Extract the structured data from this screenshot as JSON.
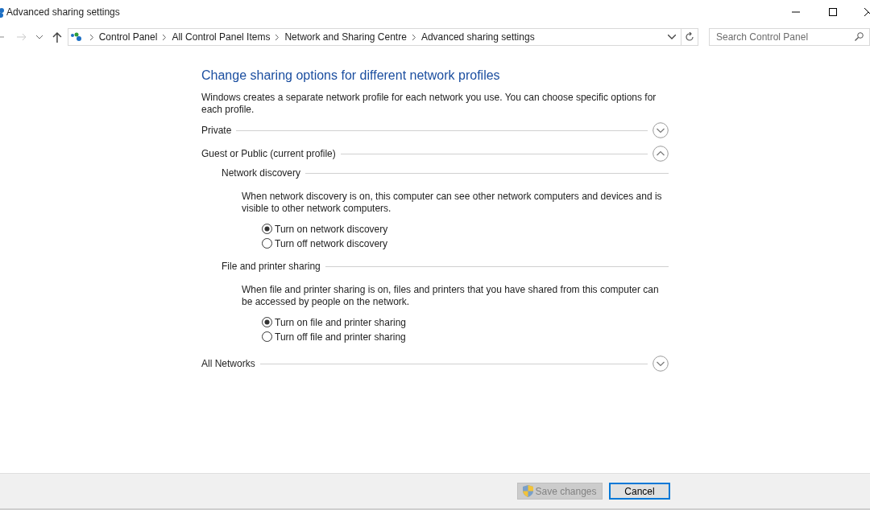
{
  "window": {
    "title": "Advanced sharing settings"
  },
  "address_bar": {
    "breadcrumbs": [
      "Control Panel",
      "All Control Panel Items",
      "Network and Sharing Centre",
      "Advanced sharing settings"
    ]
  },
  "search": {
    "placeholder": "Search Control Panel"
  },
  "heading": "Change sharing options for different network profiles",
  "intro": "Windows creates a separate network profile for each network you use. You can choose specific options for each profile.",
  "profiles": [
    {
      "title": "Private",
      "expanded": false
    },
    {
      "title": "Guest or Public (current profile)",
      "expanded": true,
      "groups": [
        {
          "title": "Network discovery",
          "description": "When network discovery is on, this computer can see other network computers and devices and is visible to other network computers.",
          "options": [
            {
              "label": "Turn on network discovery",
              "selected": true
            },
            {
              "label": "Turn off network discovery",
              "selected": false
            }
          ]
        },
        {
          "title": "File and printer sharing",
          "description": "When file and printer sharing is on, files and printers that you have shared from this computer can be accessed by people on the network.",
          "options": [
            {
              "label": "Turn on file and printer sharing",
              "selected": true
            },
            {
              "label": "Turn off file and printer sharing",
              "selected": false
            }
          ]
        }
      ]
    },
    {
      "title": "All Networks",
      "expanded": false
    }
  ],
  "buttons": [
    {
      "label": "Save changes",
      "disabled": true,
      "default": false
    },
    {
      "label": "Cancel",
      "disabled": false,
      "default": true
    }
  ]
}
